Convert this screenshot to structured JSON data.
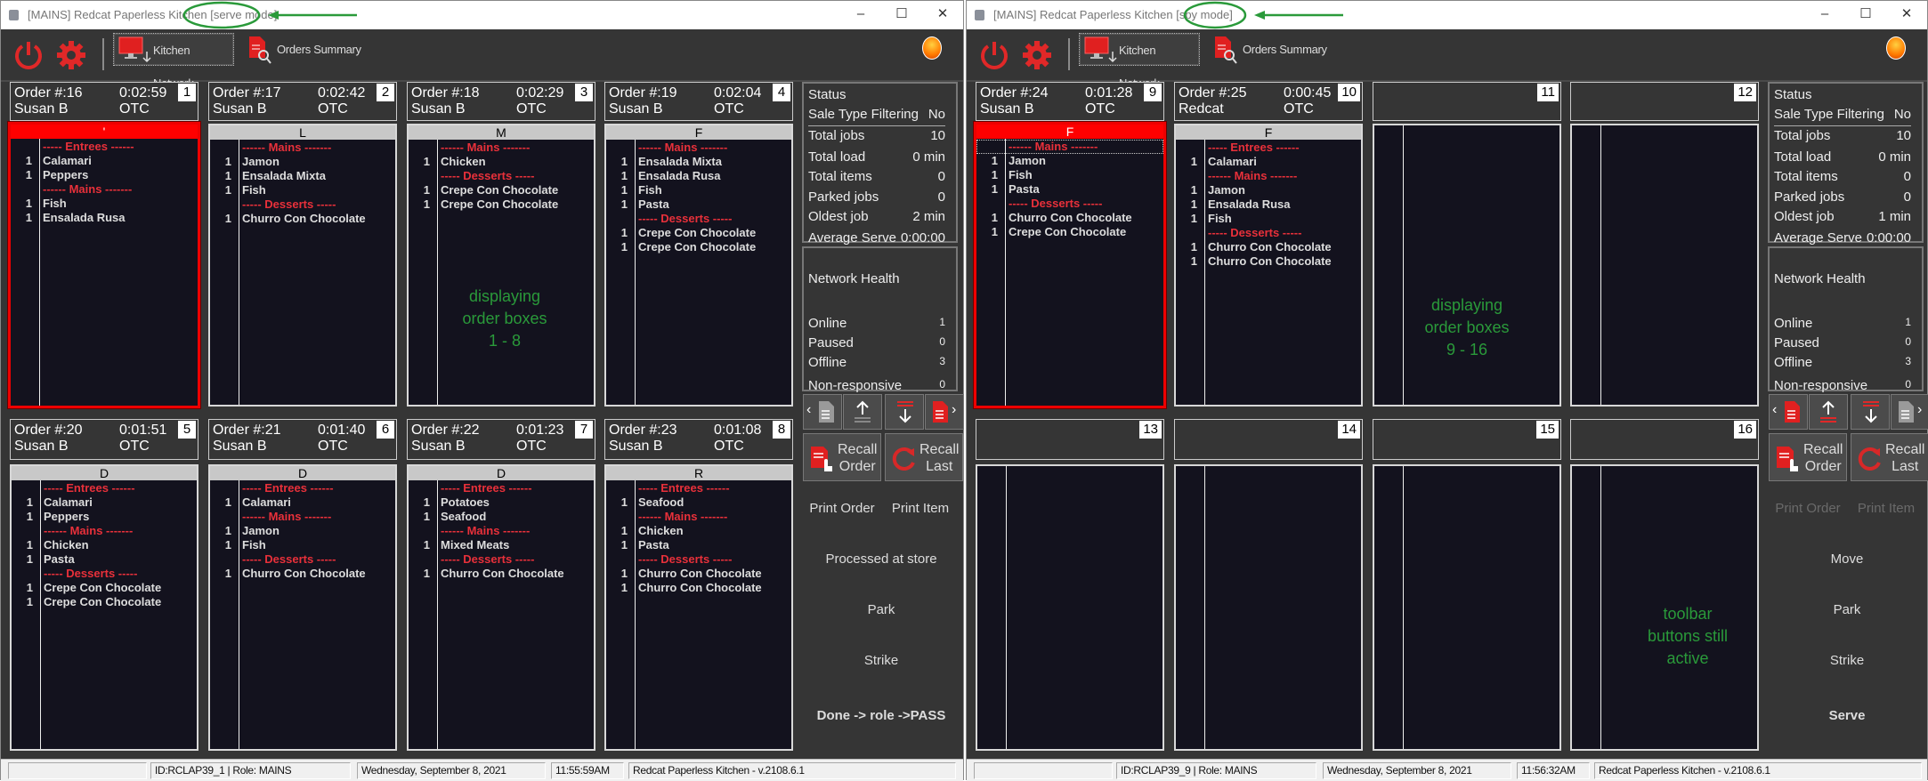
{
  "colors": {
    "accent_red": "#e8303a",
    "selected_border": "#ee0000",
    "annotation_green": "#2a9a3a",
    "background": "#353535",
    "order_body": "#13121e"
  },
  "windows": [
    {
      "title": "[MAINS] Redcat Paperless Kitchen",
      "mode": "[serve mode]",
      "controls": {
        "minimize": "–",
        "maximize": "☐",
        "close": "✕"
      },
      "toolbar": {
        "power_icon": "power-icon",
        "settings_icon": "gear-icon",
        "kitchen_network": "Kitchen Network",
        "orders_summary": "Orders Summary",
        "status_light": "orange"
      },
      "annotation": "displaying\norder boxes\n1 - 8",
      "orders": [
        {
          "slot": "1",
          "number": "Order #:16",
          "time": "0:02:59",
          "server": "Susan B",
          "type": "OTC",
          "course": "'",
          "selected": true,
          "lines": [
            {
              "qty": "",
              "text": "----- Entrees ------",
              "heading": true
            },
            {
              "qty": "1",
              "text": "Calamari"
            },
            {
              "qty": "1",
              "text": "Peppers"
            },
            {
              "qty": "",
              "text": "------ Mains -------",
              "heading": true
            },
            {
              "qty": "1",
              "text": "Fish"
            },
            {
              "qty": "1",
              "text": "Ensalada Rusa"
            }
          ]
        },
        {
          "slot": "2",
          "number": "Order #:17",
          "time": "0:02:42",
          "server": "Susan B",
          "type": "OTC",
          "course": "L",
          "lines": [
            {
              "qty": "",
              "text": "------ Mains -------",
              "heading": true
            },
            {
              "qty": "1",
              "text": "Jamon"
            },
            {
              "qty": "1",
              "text": "Ensalada Mixta"
            },
            {
              "qty": "1",
              "text": "Fish"
            },
            {
              "qty": "",
              "text": "----- Desserts -----",
              "heading": true
            },
            {
              "qty": "1",
              "text": "Churro Con Chocolate"
            }
          ]
        },
        {
          "slot": "3",
          "number": "Order #:18",
          "time": "0:02:29",
          "server": "Susan B",
          "type": "OTC",
          "course": "M",
          "lines": [
            {
              "qty": "",
              "text": "------ Mains -------",
              "heading": true
            },
            {
              "qty": "1",
              "text": "Chicken"
            },
            {
              "qty": "",
              "text": "----- Desserts -----",
              "heading": true
            },
            {
              "qty": "1",
              "text": "Crepe Con Chocolate"
            },
            {
              "qty": "1",
              "text": "Crepe Con Chocolate"
            }
          ]
        },
        {
          "slot": "4",
          "number": "Order #:19",
          "time": "0:02:04",
          "server": "Susan B",
          "type": "OTC",
          "course": "F",
          "lines": [
            {
              "qty": "",
              "text": "------ Mains -------",
              "heading": true
            },
            {
              "qty": "1",
              "text": "Ensalada Mixta"
            },
            {
              "qty": "1",
              "text": "Ensalada Rusa"
            },
            {
              "qty": "1",
              "text": "Fish"
            },
            {
              "qty": "1",
              "text": "Pasta"
            },
            {
              "qty": "",
              "text": "----- Desserts -----",
              "heading": true
            },
            {
              "qty": "1",
              "text": "Crepe Con Chocolate"
            },
            {
              "qty": "1",
              "text": "Crepe Con Chocolate"
            }
          ]
        },
        {
          "slot": "5",
          "number": "Order #:20",
          "time": "0:01:51",
          "server": "Susan B",
          "type": "OTC",
          "course": "D",
          "lines": [
            {
              "qty": "",
              "text": "----- Entrees ------",
              "heading": true
            },
            {
              "qty": "1",
              "text": "Calamari"
            },
            {
              "qty": "1",
              "text": "Peppers"
            },
            {
              "qty": "",
              "text": "------ Mains -------",
              "heading": true
            },
            {
              "qty": "1",
              "text": "Chicken"
            },
            {
              "qty": "1",
              "text": "Pasta"
            },
            {
              "qty": "",
              "text": "----- Desserts -----",
              "heading": true
            },
            {
              "qty": "1",
              "text": "Crepe Con Chocolate"
            },
            {
              "qty": "1",
              "text": "Crepe Con Chocolate"
            }
          ]
        },
        {
          "slot": "6",
          "number": "Order #:21",
          "time": "0:01:40",
          "server": "Susan B",
          "type": "OTC",
          "course": "D",
          "lines": [
            {
              "qty": "",
              "text": "----- Entrees ------",
              "heading": true
            },
            {
              "qty": "1",
              "text": "Calamari"
            },
            {
              "qty": "",
              "text": "------ Mains -------",
              "heading": true
            },
            {
              "qty": "1",
              "text": "Jamon"
            },
            {
              "qty": "1",
              "text": "Fish"
            },
            {
              "qty": "",
              "text": "----- Desserts -----",
              "heading": true
            },
            {
              "qty": "1",
              "text": "Churro Con Chocolate"
            }
          ]
        },
        {
          "slot": "7",
          "number": "Order #:22",
          "time": "0:01:23",
          "server": "Susan B",
          "type": "OTC",
          "course": "D",
          "lines": [
            {
              "qty": "",
              "text": "----- Entrees ------",
              "heading": true
            },
            {
              "qty": "1",
              "text": "Potatoes"
            },
            {
              "qty": "1",
              "text": "Seafood"
            },
            {
              "qty": "",
              "text": "------ Mains -------",
              "heading": true
            },
            {
              "qty": "1",
              "text": "Mixed Meats"
            },
            {
              "qty": "",
              "text": "----- Desserts -----",
              "heading": true
            },
            {
              "qty": "1",
              "text": "Churro Con Chocolate"
            }
          ]
        },
        {
          "slot": "8",
          "number": "Order #:23",
          "time": "0:01:08",
          "server": "Susan B",
          "type": "OTC",
          "course": "R",
          "lines": [
            {
              "qty": "",
              "text": "----- Entrees ------",
              "heading": true
            },
            {
              "qty": "1",
              "text": "Seafood"
            },
            {
              "qty": "",
              "text": "------ Mains -------",
              "heading": true
            },
            {
              "qty": "1",
              "text": "Chicken"
            },
            {
              "qty": "1",
              "text": "Pasta"
            },
            {
              "qty": "",
              "text": "----- Desserts -----",
              "heading": true
            },
            {
              "qty": "1",
              "text": "Churro Con Chocolate"
            },
            {
              "qty": "1",
              "text": "Churro Con Chocolate"
            }
          ]
        }
      ],
      "status": {
        "title": "Status",
        "rows": [
          {
            "label": "Sale Type Filtering",
            "value": "No"
          },
          {
            "label": "Total jobs",
            "value": "10"
          },
          {
            "label": "Total load",
            "value": "0 min"
          },
          {
            "label": "Total items",
            "value": "0"
          },
          {
            "label": "Parked jobs",
            "value": "0"
          },
          {
            "label": "Oldest job",
            "value": "2 min"
          },
          {
            "label": "Average Serve",
            "value": "0:00:00"
          }
        ]
      },
      "network": {
        "title": "Network Health",
        "rows": [
          {
            "label": "Online",
            "value": "1"
          },
          {
            "label": "Paused",
            "value": "0"
          },
          {
            "label": "Offline",
            "value": "3"
          },
          {
            "label": "Non-responsive",
            "value": "0"
          }
        ]
      },
      "recall_order": "Recall\nOrder",
      "recall_last": "Recall\nLast",
      "actions": [
        {
          "label": "Print Order",
          "disabled": false
        },
        {
          "label": "Print Item",
          "disabled": false
        },
        {
          "label": "Processed at store"
        },
        {
          "label": "Park"
        },
        {
          "label": "Strike"
        },
        {
          "label": "Done -> role ->PASS",
          "bold": true
        }
      ],
      "statusbar": {
        "blank": "",
        "id_role": "ID:RCLAP39_1 | Role: MAINS",
        "date": "Wednesday, September  8, 2021",
        "time": "11:55:59AM",
        "version": "Redcat Paperless Kitchen - v.2108.6.1"
      }
    },
    {
      "title": "[MAINS] Redcat Paperless Kitchen",
      "mode": "[spy mode]",
      "controls": {
        "minimize": "–",
        "maximize": "☐",
        "close": "✕"
      },
      "toolbar": {
        "power_icon": "power-icon",
        "settings_icon": "gear-icon",
        "kitchen_network": "Kitchen Network",
        "orders_summary": "Orders Summary",
        "status_light": "orange"
      },
      "annotation": "displaying\norder boxes\n9 - 16",
      "annotation2": "toolbar\nbuttons still\nactive",
      "orders": [
        {
          "slot": "9",
          "number": "Order #:24",
          "time": "0:01:28",
          "server": "Susan B",
          "type": "OTC",
          "course": "F",
          "selected": true,
          "focus_line": 0,
          "lines": [
            {
              "qty": "",
              "text": "------ Mains -------",
              "heading": true
            },
            {
              "qty": "1",
              "text": "Jamon"
            },
            {
              "qty": "1",
              "text": "Fish"
            },
            {
              "qty": "1",
              "text": "Pasta"
            },
            {
              "qty": "",
              "text": "----- Desserts -----",
              "heading": true
            },
            {
              "qty": "1",
              "text": "Churro Con Chocolate"
            },
            {
              "qty": "1",
              "text": "Crepe Con Chocolate"
            }
          ]
        },
        {
          "slot": "10",
          "number": "Order #:25",
          "time": "0:00:45",
          "server": "Redcat",
          "type": "OTC",
          "course": "F",
          "lines": [
            {
              "qty": "",
              "text": "----- Entrees ------",
              "heading": true
            },
            {
              "qty": "1",
              "text": "Calamari"
            },
            {
              "qty": "",
              "text": "------ Mains -------",
              "heading": true
            },
            {
              "qty": "1",
              "text": "Jamon"
            },
            {
              "qty": "1",
              "text": "Ensalada Rusa"
            },
            {
              "qty": "1",
              "text": "Fish"
            },
            {
              "qty": "",
              "text": "----- Desserts -----",
              "heading": true
            },
            {
              "qty": "1",
              "text": "Churro Con Chocolate"
            },
            {
              "qty": "1",
              "text": "Churro Con Chocolate"
            }
          ]
        },
        {
          "slot": "11",
          "lines": []
        },
        {
          "slot": "12",
          "lines": []
        },
        {
          "slot": "13",
          "lines": []
        },
        {
          "slot": "14",
          "lines": []
        },
        {
          "slot": "15",
          "lines": []
        },
        {
          "slot": "16",
          "lines": []
        }
      ],
      "status": {
        "title": "Status",
        "rows": [
          {
            "label": "Sale Type Filtering",
            "value": "No"
          },
          {
            "label": "Total jobs",
            "value": "10"
          },
          {
            "label": "Total load",
            "value": "0 min"
          },
          {
            "label": "Total items",
            "value": "0"
          },
          {
            "label": "Parked jobs",
            "value": "0"
          },
          {
            "label": "Oldest job",
            "value": "1 min"
          },
          {
            "label": "Average Serve",
            "value": "0:00:00"
          }
        ]
      },
      "network": {
        "title": "Network Health",
        "rows": [
          {
            "label": "Online",
            "value": "1"
          },
          {
            "label": "Paused",
            "value": "0"
          },
          {
            "label": "Offline",
            "value": "3"
          },
          {
            "label": "Non-responsive",
            "value": "0"
          }
        ]
      },
      "recall_order": "Recall\nOrder",
      "recall_last": "Recall\nLast",
      "actions": [
        {
          "label": "Print Order",
          "disabled": true
        },
        {
          "label": "Print Item",
          "disabled": true
        },
        {
          "label": "Move"
        },
        {
          "label": "Park"
        },
        {
          "label": "Strike"
        },
        {
          "label": "Serve",
          "bold": true
        }
      ],
      "statusbar": {
        "blank": "",
        "id_role": "ID:RCLAP39_9 | Role: MAINS",
        "date": "Wednesday, September  8, 2021",
        "time": "11:56:32AM",
        "version": "Redcat Paperless Kitchen - v.2108.6.1"
      }
    }
  ]
}
